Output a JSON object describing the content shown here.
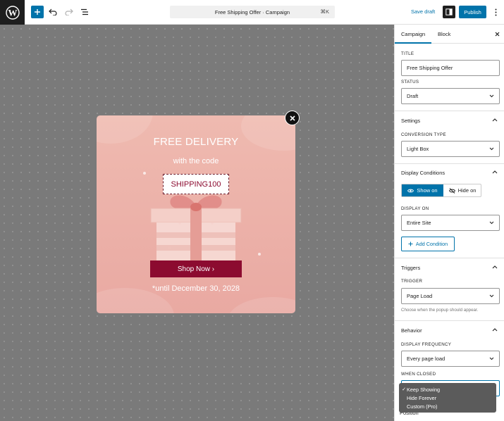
{
  "topbar": {
    "document_title": "Free Shipping Offer · Campaign",
    "shortcut": "⌘K",
    "save_draft": "Save draft",
    "publish": "Publish"
  },
  "popup": {
    "title": "FREE DELIVERY",
    "subtitle": "with the code",
    "code": "SHIPPING100",
    "button": "Shop Now ›",
    "until": "*until December 30, 2028",
    "background_color": "#eab0a8",
    "button_color": "#8c0b30"
  },
  "sidebar": {
    "tabs": [
      "Campaign",
      "Block"
    ],
    "title_label": "TITLE",
    "title_value": "Free Shipping Offer",
    "status_label": "STATUS",
    "status_value": "Draft",
    "settings": {
      "heading": "Settings",
      "conversion_label": "CONVERSION TYPE",
      "conversion_value": "Light Box"
    },
    "display_conditions": {
      "heading": "Display Conditions",
      "show_on": "Show on",
      "hide_on": "Hide on",
      "display_on_label": "DISPLAY ON",
      "display_on_value": "Entire Site",
      "add_condition": "Add Condition"
    },
    "triggers": {
      "heading": "Triggers",
      "trigger_label": "TRIGGER",
      "trigger_value": "Page Load",
      "help": "Choose when the popup should appear."
    },
    "behavior": {
      "heading": "Behavior",
      "frequency_label": "DISPLAY FREQUENCY",
      "frequency_value": "Every page load",
      "when_closed_label": "WHEN CLOSED",
      "when_closed_options": [
        "Keep Showing",
        "Hide Forever",
        "Custom (Pro)"
      ],
      "when_closed_selected": "Keep Showing"
    },
    "position_label": "Position"
  },
  "colors": {
    "accent": "#0073aa",
    "canvas": "#7a7a7a"
  }
}
